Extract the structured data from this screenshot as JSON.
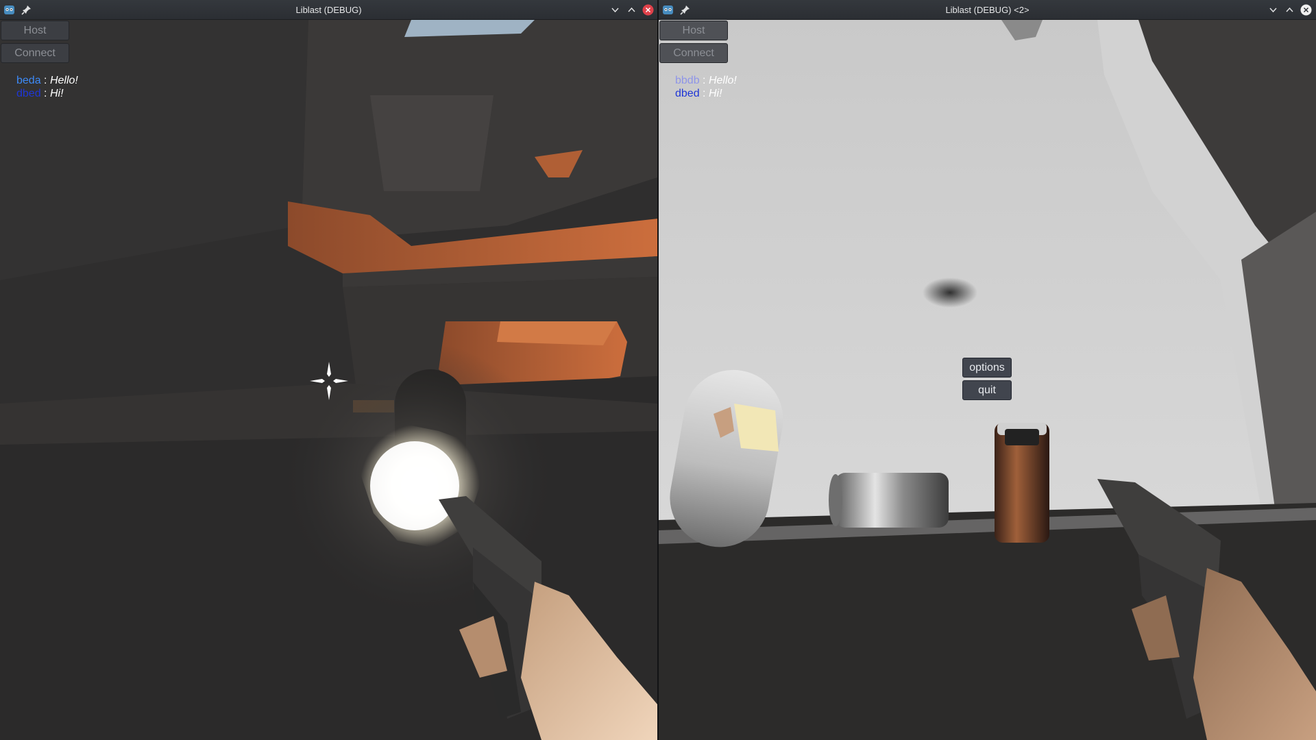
{
  "windows": [
    {
      "title": "Liblast (DEBUG)",
      "buttons": {
        "host": "Host",
        "connect": "Connect"
      },
      "chat": [
        {
          "user": "beda",
          "user_color": "#3d8af7",
          "separator": ":",
          "text": "Hello!"
        },
        {
          "user": "dbed",
          "user_color": "#1f36d6",
          "separator": ":",
          "text": "Hi!"
        }
      ]
    },
    {
      "title": "Liblast (DEBUG) <2>",
      "buttons": {
        "host": "Host",
        "connect": "Connect"
      },
      "chat": [
        {
          "user": "bbdb",
          "user_color": "#8f95e8",
          "separator": ":",
          "text": "Hello!"
        },
        {
          "user": "dbed",
          "user_color": "#1f36d6",
          "separator": ":",
          "text": "Hi!"
        }
      ],
      "menu": {
        "options": "options",
        "quit": "quit"
      }
    }
  ],
  "colors": {
    "accent_orange": "#c0673a",
    "titlebar": "#2f3237",
    "close_red": "#e0414a"
  },
  "icons": [
    "app-icon",
    "pin-icon",
    "minimize-icon",
    "maximize-icon",
    "close-icon",
    "crosshair-icon"
  ]
}
